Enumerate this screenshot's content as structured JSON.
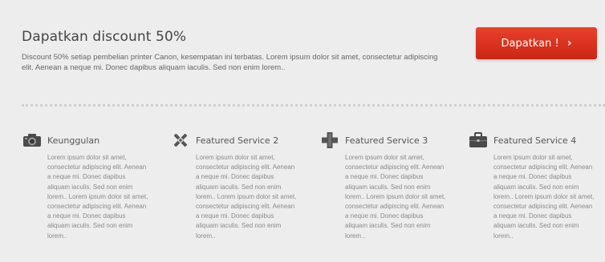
{
  "promo": {
    "title": "Dapatkan discount 50%",
    "text": "Discount 50% setiap pembelian printer Canon, kesempatan ini terbatas. Lorem ipsum dolor sit amet, consectetur adipiscing elit. Aenean a neque mi. Donec dapibus aliquam iaculis. Sed non enim lorem..",
    "button_label": "Dapatkan !",
    "button_chevron": "›",
    "accent_color": "#d9311d"
  },
  "features": [
    {
      "icon": "camera-icon",
      "title": "Keunggulan",
      "text": "Lorem ipsum dolor sit amet, consectetur adipiscing elit. Aenean a neque mi. Donec dapibus aliquam iaculis. Sed non enim lorem.. Lorem ipsum dolor sit amet, consectetur adipiscing elit. Aenean a neque mi. Donec dapibus aliquam iaculis. Sed non enim lorem.."
    },
    {
      "icon": "tools-icon",
      "title": "Featured Service 2",
      "text": "Lorem ipsum dolor sit amet, consectetur adipiscing elit. Aenean a neque mi. Donec dapibus aliquam iaculis. Sed non enim lorem.. Lorem ipsum dolor sit amet, consectetur adipiscing elit. Aenean a neque mi. Donec dapibus aliquam iaculis. Sed non enim lorem.."
    },
    {
      "icon": "medical-cross-icon",
      "title": "Featured Service 3",
      "text": "Lorem ipsum dolor sit amet, consectetur adipiscing elit. Aenean a neque mi. Donec dapibus aliquam iaculis. Sed non enim lorem.. Lorem ipsum dolor sit amet, consectetur adipiscing elit. Aenean a neque mi. Donec dapibus aliquam iaculis. Sed non enim lorem.."
    },
    {
      "icon": "briefcase-icon",
      "title": "Featured Service 4",
      "text": "Lorem ipsum dolor sit amet, consectetur adipiscing elit. Aenean a neque mi. Donec dapibus aliquam iaculis. Sed non enim lorem.. Lorem ipsum dolor sit amet, consectetur adipiscing elit. Aenean a neque mi. Donec dapibus aliquam iaculis. Sed non enim lorem.."
    }
  ]
}
